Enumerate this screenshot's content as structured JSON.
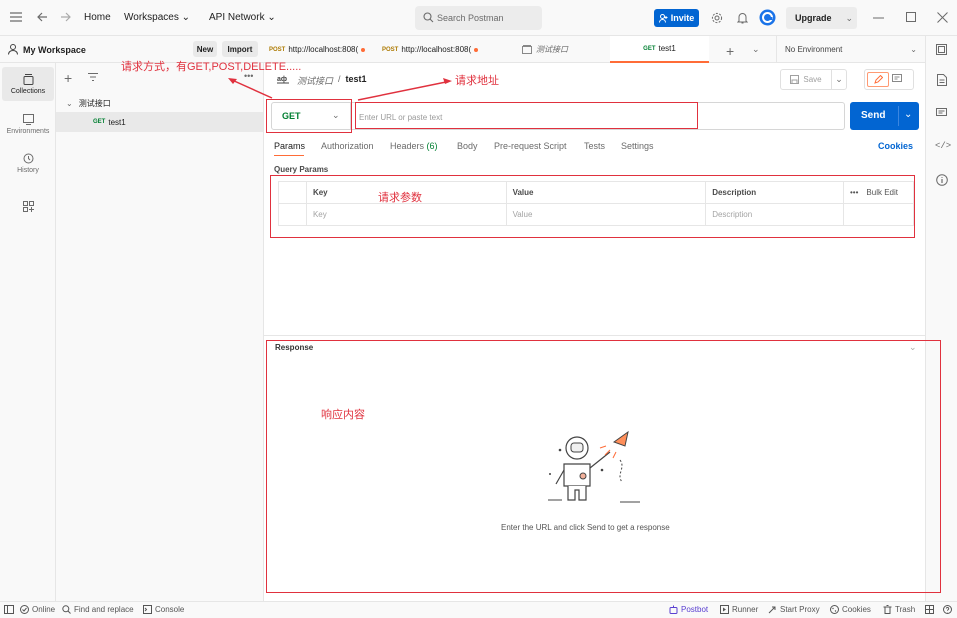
{
  "titlebar": {
    "menu_icon": "hamburger-icon",
    "home": "Home",
    "workspaces": "Workspaces",
    "api_network": "API Network",
    "search_placeholder": "Search Postman",
    "invite": "Invite",
    "upgrade": "Upgrade"
  },
  "workspace": {
    "name": "My Workspace",
    "new_label": "New",
    "import_label": "Import"
  },
  "tabs": [
    {
      "method": "POST",
      "label": "http://localhost:808("
    },
    {
      "method": "POST",
      "label": "http://localhost:808("
    },
    {
      "method": "",
      "label": "测试接口"
    },
    {
      "method": "GET",
      "label": "test1"
    }
  ],
  "environment": "No Environment",
  "rail": {
    "collections": "Collections",
    "environments": "Environments",
    "history": "History"
  },
  "sidebar": {
    "folder": "测试接口",
    "request_method": "GET",
    "request_name": "test1"
  },
  "breadcrumb": {
    "collection": "测试接口",
    "separator": "/",
    "request": "test1"
  },
  "save_label": "Save",
  "request": {
    "method": "GET",
    "url_placeholder": "Enter URL or paste text",
    "send_label": "Send"
  },
  "req_tabs": {
    "params": "Params",
    "authorization": "Authorization",
    "headers": "Headers",
    "headers_count": "(6)",
    "body": "Body",
    "prerequest": "Pre-request Script",
    "tests": "Tests",
    "settings": "Settings",
    "cookies": "Cookies"
  },
  "query_params": {
    "title": "Query Params",
    "headers": [
      "Key",
      "Value",
      "Description"
    ],
    "bulk_edit": "Bulk Edit",
    "placeholder_row": [
      "Key",
      "Value",
      "Description"
    ]
  },
  "response": {
    "title": "Response",
    "empty_message": "Enter the URL and click Send to get a response"
  },
  "annotations": {
    "method": "请求方式，有GET,POST,DELETE.....",
    "url": "请求地址",
    "params": "请求参数",
    "response": "响应内容"
  },
  "statusbar": {
    "online": "Online",
    "find_replace": "Find and replace",
    "console": "Console",
    "postbot": "Postbot",
    "runner": "Runner",
    "start_proxy": "Start Proxy",
    "cookies": "Cookies",
    "trash": "Trash"
  },
  "colors": {
    "accent": "#0265d2",
    "brand": "#ff6c37",
    "annotation": "#e0313e",
    "get": "#007f31",
    "post": "#ad7a03"
  }
}
